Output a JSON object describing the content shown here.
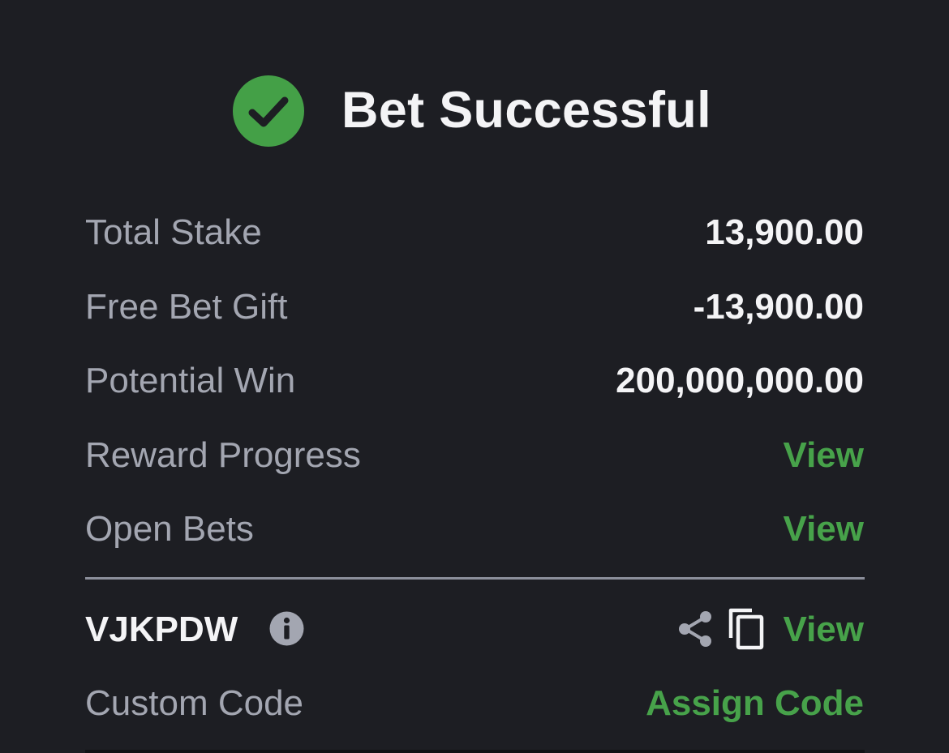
{
  "header": {
    "title": "Bet Successful",
    "status_icon": "check-circle-icon",
    "status_color": "#44a047"
  },
  "summary": [
    {
      "label": "Total Stake",
      "value": "13,900.00"
    },
    {
      "label": "Free Bet Gift",
      "value": "-13,900.00"
    },
    {
      "label": "Potential Win",
      "value": "200,000,000.00"
    }
  ],
  "links": {
    "reward_progress": {
      "label": "Reward Progress",
      "action": "View"
    },
    "open_bets": {
      "label": "Open Bets",
      "action": "View"
    }
  },
  "booking": {
    "code": "VJKPDW",
    "info_icon": "info-icon",
    "share_icon": "share-icon",
    "copy_icon": "copy-icon",
    "action": "View"
  },
  "custom_code": {
    "label": "Custom Code",
    "action": "Assign Code"
  },
  "colors": {
    "background": "#1d1e23",
    "accent": "#47a24a",
    "label": "#a3a6b1",
    "value": "#f4f4f6"
  }
}
